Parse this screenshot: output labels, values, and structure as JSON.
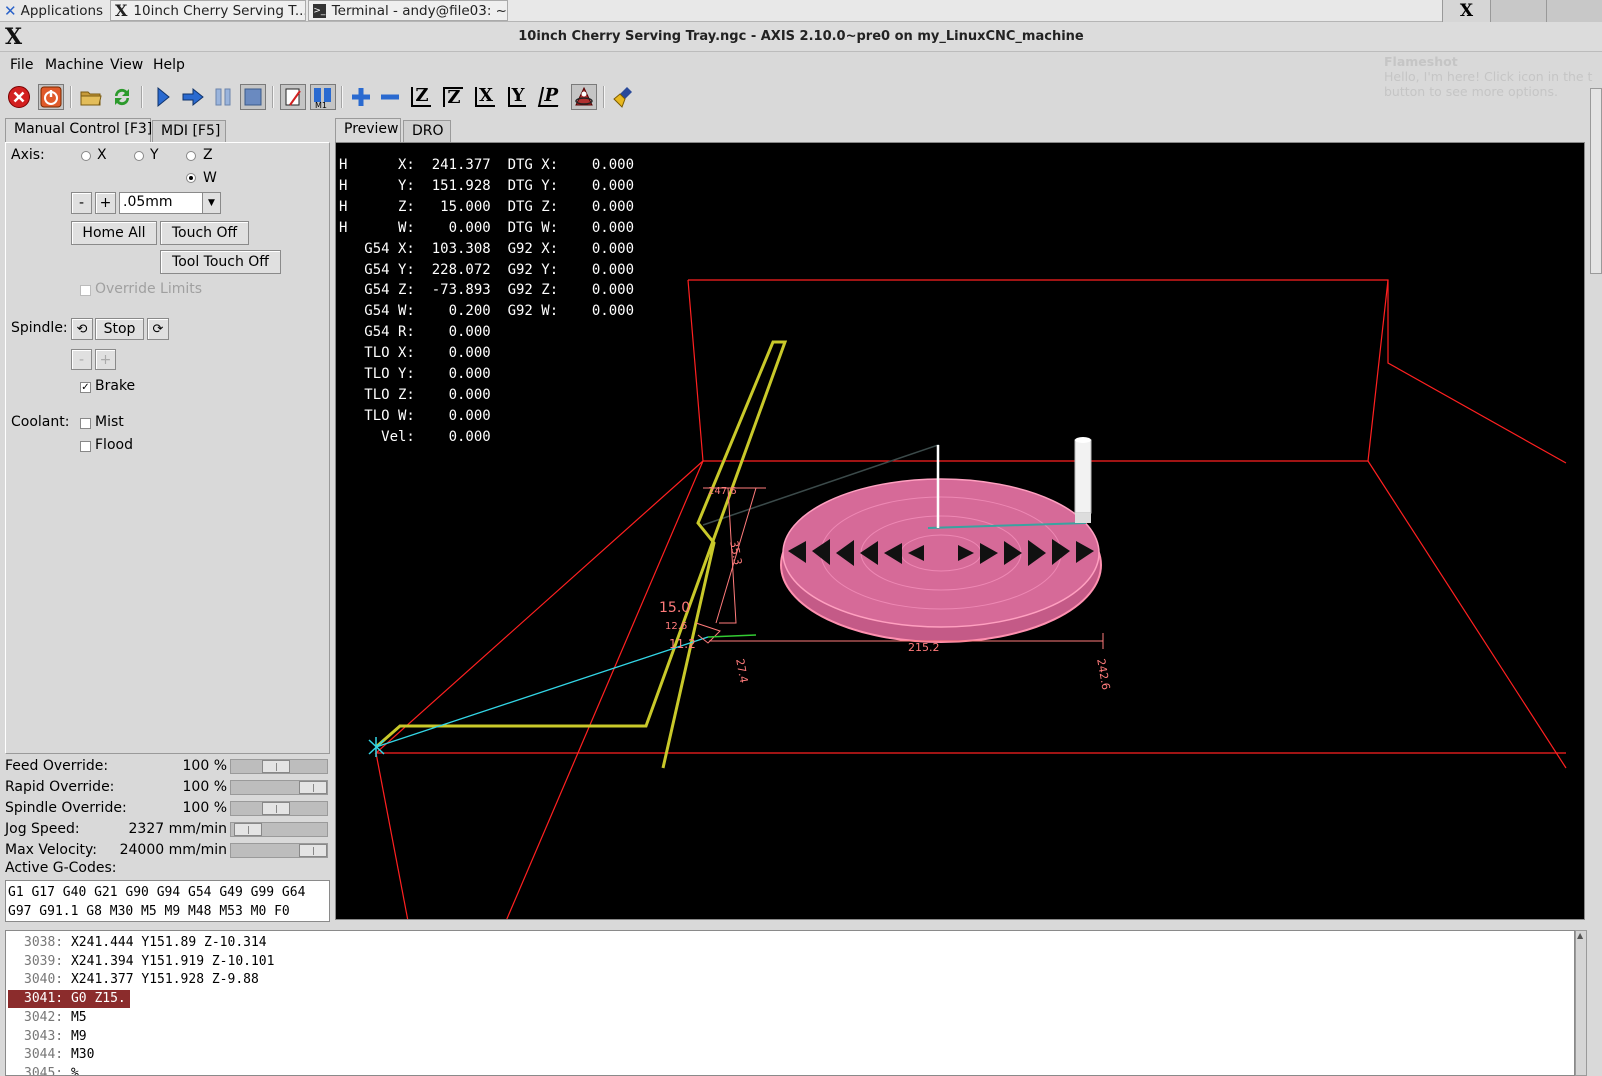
{
  "taskbar": {
    "applications_label": "Applications",
    "tasks": [
      {
        "label": "10inch Cherry Serving T..."
      },
      {
        "label": "Terminal - andy@file03: ~"
      }
    ]
  },
  "window": {
    "title": "10inch Cherry Serving Tray.ngc - AXIS 2.10.0~pre0 on my_LinuxCNC_machine",
    "logo": "X"
  },
  "menu": [
    "File",
    "Machine",
    "View",
    "Help"
  ],
  "flameshot": {
    "title": "Flameshot",
    "text": "Hello, I'm here! Click icon in the t button to see more options."
  },
  "toolbar_icons": [
    "estop-icon",
    "machine-power-icon",
    "open-file-icon",
    "reload-icon",
    "run-icon",
    "step-icon",
    "pause-icon",
    "stop-icon",
    "block-delete-icon",
    "optional-stop-icon",
    "zoom-in-icon",
    "zoom-out-icon",
    "view-z-icon",
    "view-z2-icon",
    "view-x-icon",
    "view-y-icon",
    "view-p-icon",
    "rotate-view-icon",
    "clear-plot-icon"
  ],
  "toolbar_axis_labels": {
    "z": "Z",
    "z2": "Z",
    "x": "X",
    "y": "Y",
    "p": "P"
  },
  "left_tabs": [
    "Manual Control [F3]",
    "MDI [F5]"
  ],
  "manual": {
    "axis_label": "Axis:",
    "axes": [
      {
        "label": "X",
        "selected": false
      },
      {
        "label": "Y",
        "selected": false
      },
      {
        "label": "Z",
        "selected": false
      },
      {
        "label": "W",
        "selected": true
      }
    ],
    "minus": "-",
    "plus": "+",
    "jog_increment": ".05mm",
    "home_all": "Home All",
    "touch_off": "Touch Off",
    "tool_touch_off": "Tool Touch Off",
    "override_limits": "Override Limits",
    "spindle_label": "Spindle:",
    "spindle_stop": "Stop",
    "spindle_minus": "-",
    "spindle_plus": "+",
    "brake_label": "Brake",
    "brake_checked": true,
    "coolant_label": "Coolant:",
    "mist_label": "Mist",
    "flood_label": "Flood"
  },
  "sliders": [
    {
      "name": "Feed Override:",
      "value": "100 %",
      "fraction": 0.45
    },
    {
      "name": "Rapid Override:",
      "value": "100 %",
      "fraction": 1.0
    },
    {
      "name": "Spindle Override:",
      "value": "100 %",
      "fraction": 0.45
    },
    {
      "name": "Jog Speed:",
      "value": "2327 mm/min",
      "fraction": 0.05
    },
    {
      "name": "Max Velocity:",
      "value": "24000 mm/min",
      "fraction": 1.0
    }
  ],
  "active_gcodes": {
    "label": "Active G-Codes:",
    "line1": "G1 G17 G40 G21 G90 G94 G54 G49 G99 G64",
    "line2": "G97 G91.1 G8 M30 M5 M9 M48 M53 M0 F0"
  },
  "preview_tabs": [
    "Preview",
    "DRO"
  ],
  "dro_lines": [
    "H      X:  241.377  DTG X:    0.000",
    "H      Y:  151.928  DTG Y:    0.000",
    "H      Z:   15.000  DTG Z:    0.000",
    "H      W:    0.000  DTG W:    0.000",
    "   G54 X:  103.308  G92 X:    0.000",
    "   G54 Y:  228.072  G92 Y:    0.000",
    "   G54 Z:  -73.893  G92 Z:    0.000",
    "   G54 W:    0.200  G92 W:    0.000",
    "   G54 R:    0.000",
    "   TLO X:    0.000",
    "   TLO Y:    0.000",
    "   TLO Z:    0.000",
    "   TLO W:    0.000",
    "     Vel:    0.000"
  ],
  "dimensions": {
    "d1": "215.2",
    "d2": "242.6",
    "d3": "27.4",
    "d4": "35.3",
    "d5": "15.0",
    "d6": "11.2",
    "d7": "247.6",
    "d8": "12.6"
  },
  "code_lines": [
    {
      "num": "3038:",
      "text": "X241.444 Y151.89 Z-10.314",
      "active": false
    },
    {
      "num": "3039:",
      "text": "X241.394 Y151.919 Z-10.101",
      "active": false
    },
    {
      "num": "3040:",
      "text": "X241.377 Y151.928 Z-9.88",
      "active": false
    },
    {
      "num": "3041:",
      "text": "G0 Z15.",
      "active": true
    },
    {
      "num": "3042:",
      "text": "M5",
      "active": false
    },
    {
      "num": "3043:",
      "text": "M9",
      "active": false
    },
    {
      "num": "3044:",
      "text": "M30",
      "active": false
    },
    {
      "num": "3045:",
      "text": "%",
      "active": false
    }
  ],
  "colors": {
    "accent_highlight": "#8b2c2c",
    "boundary": "#ff2020",
    "toolpath_feed": "#ff7fb5",
    "machine_path": "#cccc2a",
    "rapid": "#33d6e6"
  }
}
